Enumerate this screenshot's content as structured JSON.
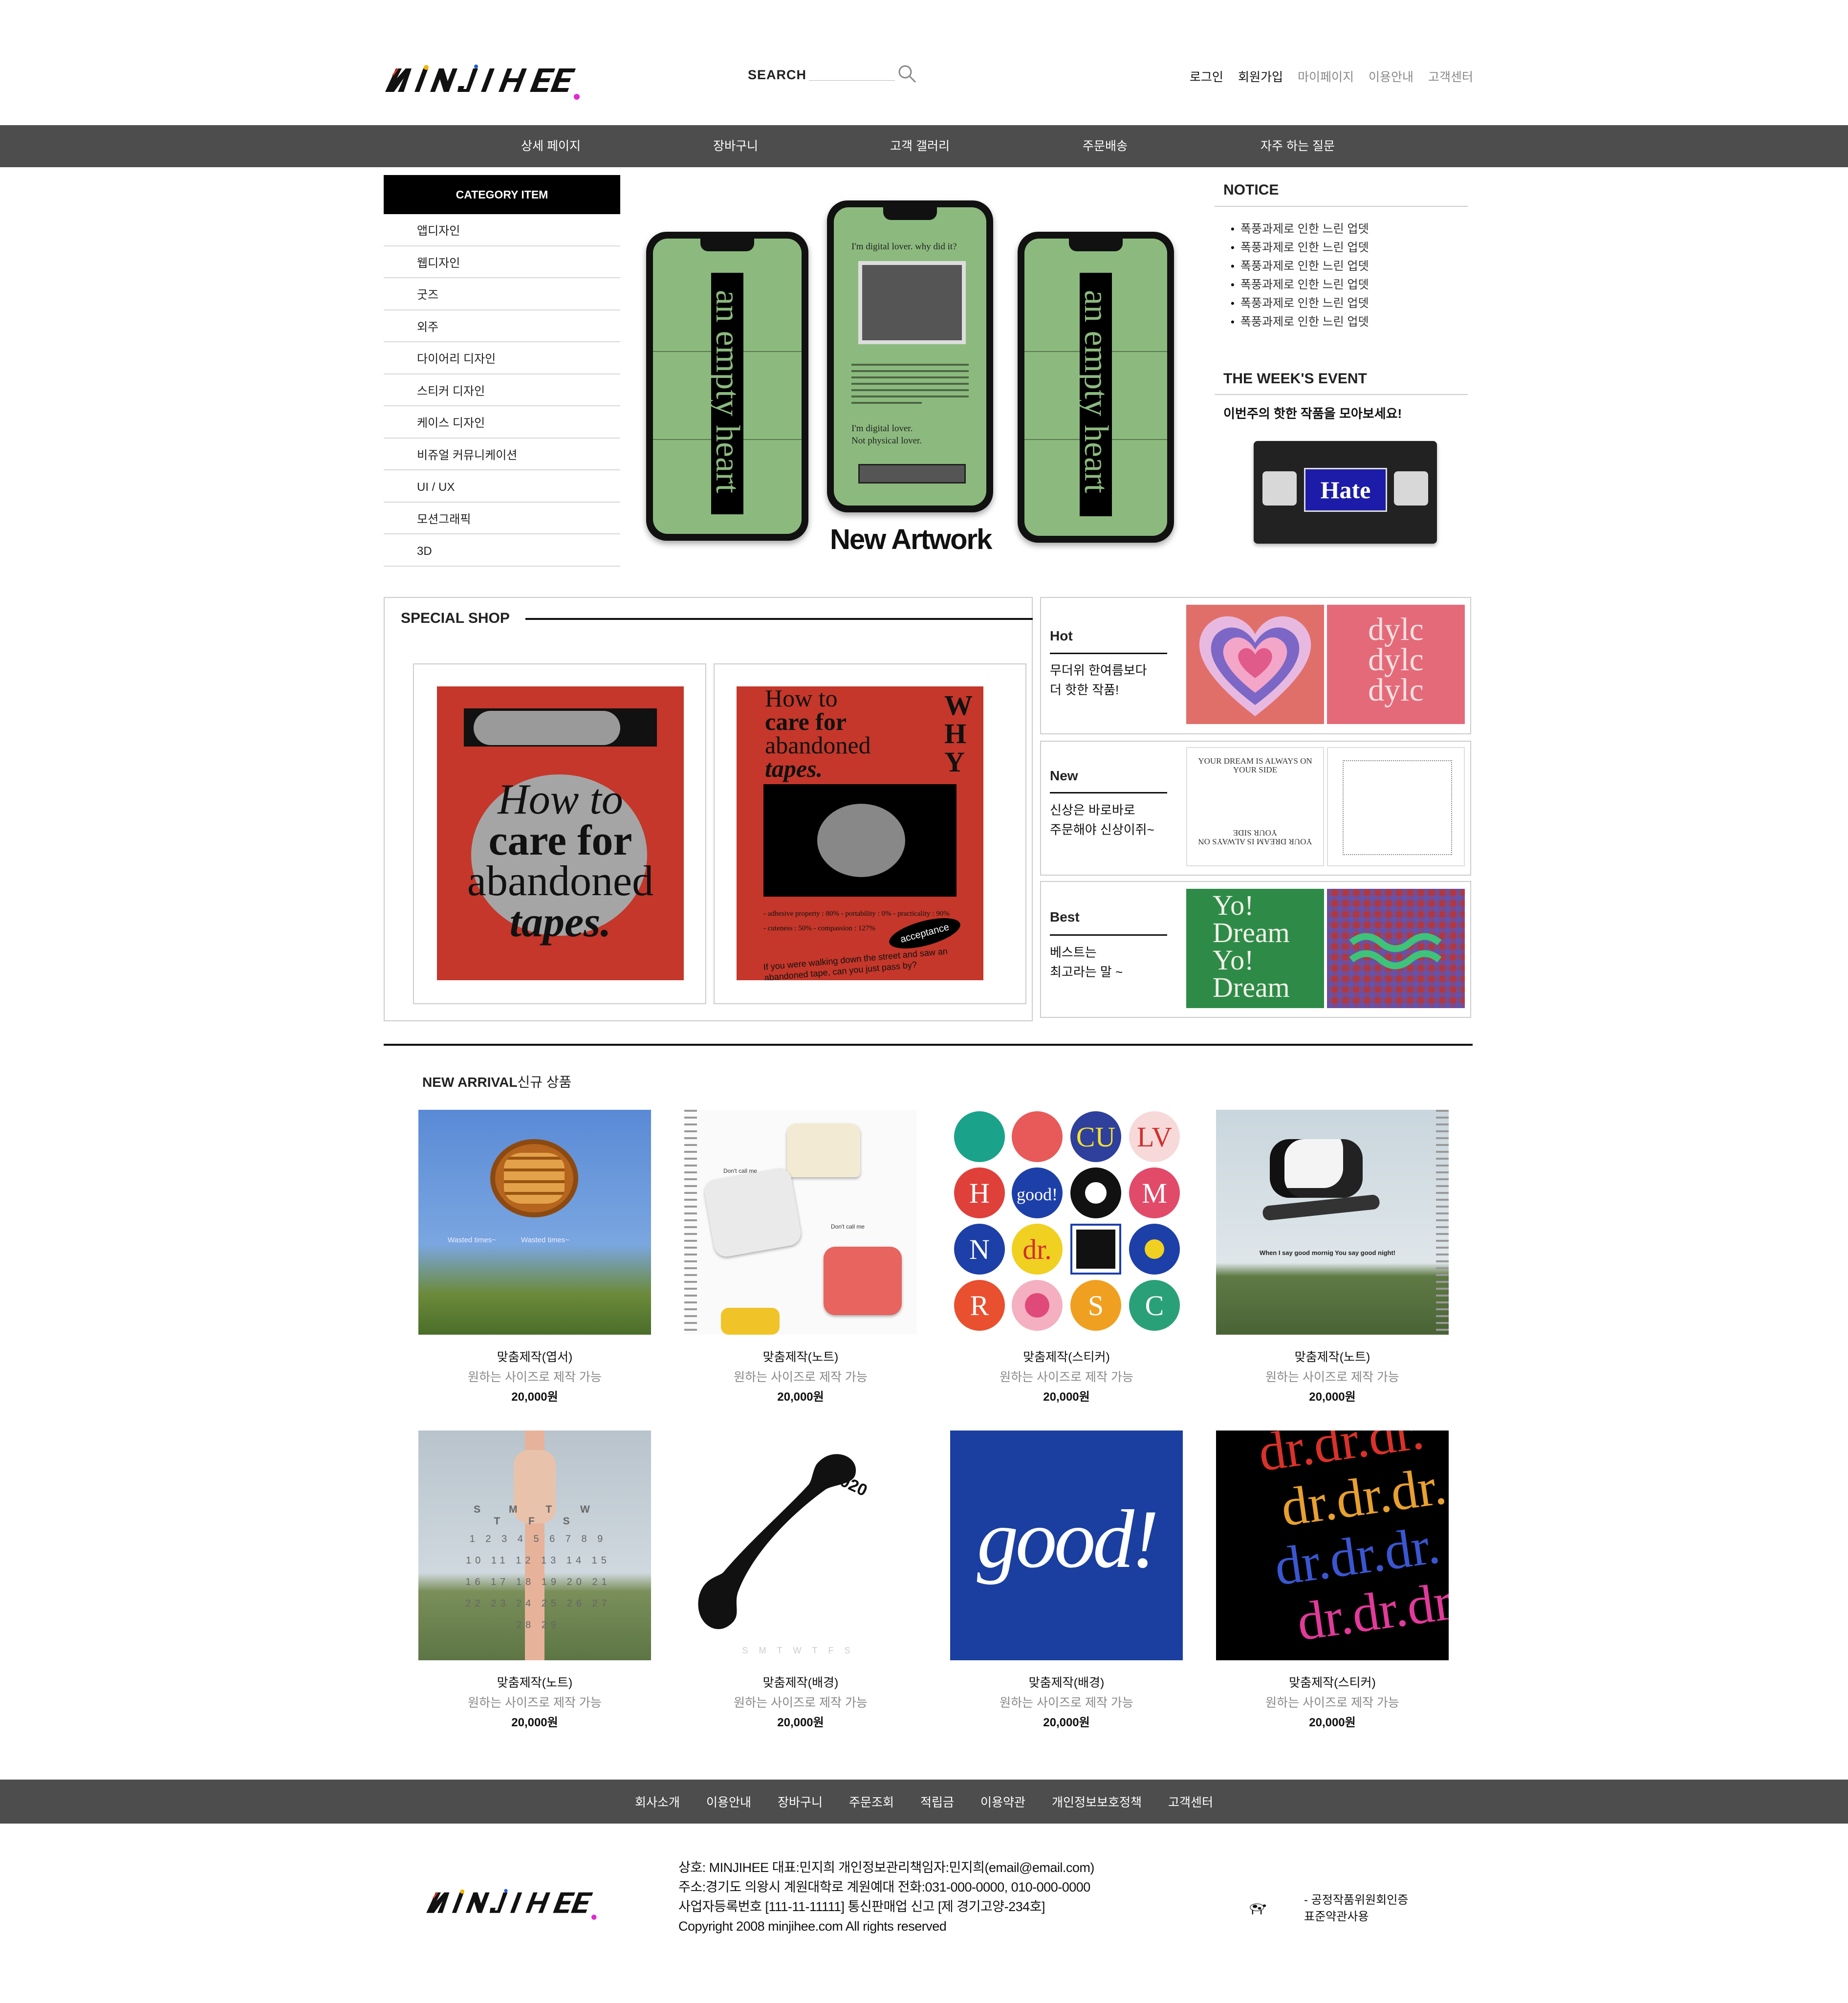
{
  "header": {
    "logo_text": "MINJIHEE",
    "search_label": "SEARCH",
    "search_placeholder": "",
    "top_links": [
      "로그인",
      "회원가입",
      "마이페이지",
      "이용안내",
      "고객센터"
    ]
  },
  "nav": [
    "상세 페이지",
    "장바구니",
    "고객 갤러리",
    "주문배송",
    "자주 하는 질문"
  ],
  "sidebar": {
    "title": "CATEGORY ITEM",
    "items": [
      "앱디자인",
      "웹디자인",
      "굿즈",
      "외주",
      "다이어리 디자인",
      "스티커 디자인",
      "케이스 디자인",
      "비쥬얼 커뮤니케이션",
      "UI / UX",
      "모션그래픽",
      "3D"
    ]
  },
  "hero": {
    "title": "New Artwork",
    "phone_text": "an empty heart",
    "center_line1": "I'm digital lover.  why did it?",
    "center_line2": "I'm digital lover.",
    "center_line3": "Not physical lover."
  },
  "notice": {
    "title": "NOTICE",
    "items": [
      "폭풍과제로 인한 느린 업뎃",
      "폭풍과제로 인한 느린 업뎃",
      "폭풍과제로 인한 느린 업뎃",
      "폭풍과제로 인한 느린 업뎃",
      "폭풍과제로 인한 느린 업뎃",
      "폭풍과제로 인한 느린 업뎃"
    ]
  },
  "event": {
    "title": "THE WEEK'S EVENT",
    "subtitle": "이번주의 핫한 작품을 모아보세요!",
    "vhs_label": "Hate"
  },
  "special": {
    "title": "SPECIAL SHOP",
    "card1_text": [
      "How to",
      "care for",
      "abandoned",
      "tapes."
    ],
    "card2_title": [
      "How to",
      "care for",
      "abandoned",
      "tapes."
    ],
    "card2_side": "WHY",
    "card2_stats": [
      "- adhesive property : 80% - portability : 0% - practicality : 90%",
      "- cuteness : 50% - compassion : 127%"
    ],
    "card2_badge": "acceptance",
    "card2_footer": "If you were walking down the street and saw an abandoned tape, can you just pass by?"
  },
  "categories": [
    {
      "title": "Hot",
      "desc": [
        "무더위 한여름보다",
        "더 핫한 작품!"
      ],
      "thumb2_text": [
        "dylc",
        "dylc",
        "dylc"
      ]
    },
    {
      "title": "New",
      "desc": [
        "신상은 바로바로",
        "주문해야 신상이쥐~"
      ],
      "thumb1_text": "YOUR DREAM IS ALWAYS ON YOUR SIDE"
    },
    {
      "title": "Best",
      "desc": [
        "베스트는",
        "최고라는 말 ~"
      ],
      "thumb1_text": [
        "Yo!",
        "Dream",
        "Yo!",
        "Dream"
      ]
    }
  ],
  "arrival": {
    "title_bold": "NEW ARRIVAL",
    "title_kor": "신규 상품",
    "products": [
      {
        "name": "맞춤제작(엽서)",
        "desc": "원하는 사이즈로 제작 가능",
        "price": "20,000원",
        "img_text": "Wasted times~"
      },
      {
        "name": "맞춤제작(노트)",
        "desc": "원하는 사이즈로 제작 가능",
        "price": "20,000원",
        "img_text": "Don't call me"
      },
      {
        "name": "맞춤제작(스티커)",
        "desc": "원하는 사이즈로 제작 가능",
        "price": "20,000원",
        "img_text": ""
      },
      {
        "name": "맞춤제작(노트)",
        "desc": "원하는 사이즈로 제작 가능",
        "price": "20,000원",
        "img_text": "When I say good mornig You say good night!"
      },
      {
        "name": "맞춤제작(노트)",
        "desc": "원하는 사이즈로 제작 가능",
        "price": "20,000원",
        "img_text": "S M T W T F S"
      },
      {
        "name": "맞춤제작(배경)",
        "desc": "원하는 사이즈로 제작 가능",
        "price": "20,000원",
        "img_text": "2020"
      },
      {
        "name": "맞춤제작(배경)",
        "desc": "원하는 사이즈로 제작 가능",
        "price": "20,000원",
        "img_text": "good!"
      },
      {
        "name": "맞춤제작(스티커)",
        "desc": "원하는 사이즈로 제작 가능",
        "price": "20,000원",
        "img_text": "dr.dr.dr."
      }
    ]
  },
  "footer": {
    "links": [
      "회사소개",
      "이용안내",
      "장바구니",
      "주문조회",
      "적립금",
      "이용약관",
      "개인정보보호정책",
      "고객센터"
    ],
    "info": [
      "상호: MINJIHEE 대표:민지희 개인정보관리책임자:민지희(email@email.com)",
      "주소:경기도 의왕시 계원대학로 계원예대 전화:031-000-0000, 010-000-0000",
      "사업자등록번호 [111-11-11111] 통신판매업 신고 [제 경기고양-234호]",
      "Copyright 2008 minjihee.com All rights reserved"
    ],
    "badge": [
      "- 공정작품위원회인증",
      "표준약관사용"
    ]
  },
  "colors": {
    "nav_bg": "#4d4d4d",
    "category_head_bg": "#000000",
    "phone_green": "#8cba7e",
    "poster_red": "#c4372a",
    "accent_blue": "#1a3fa0"
  }
}
